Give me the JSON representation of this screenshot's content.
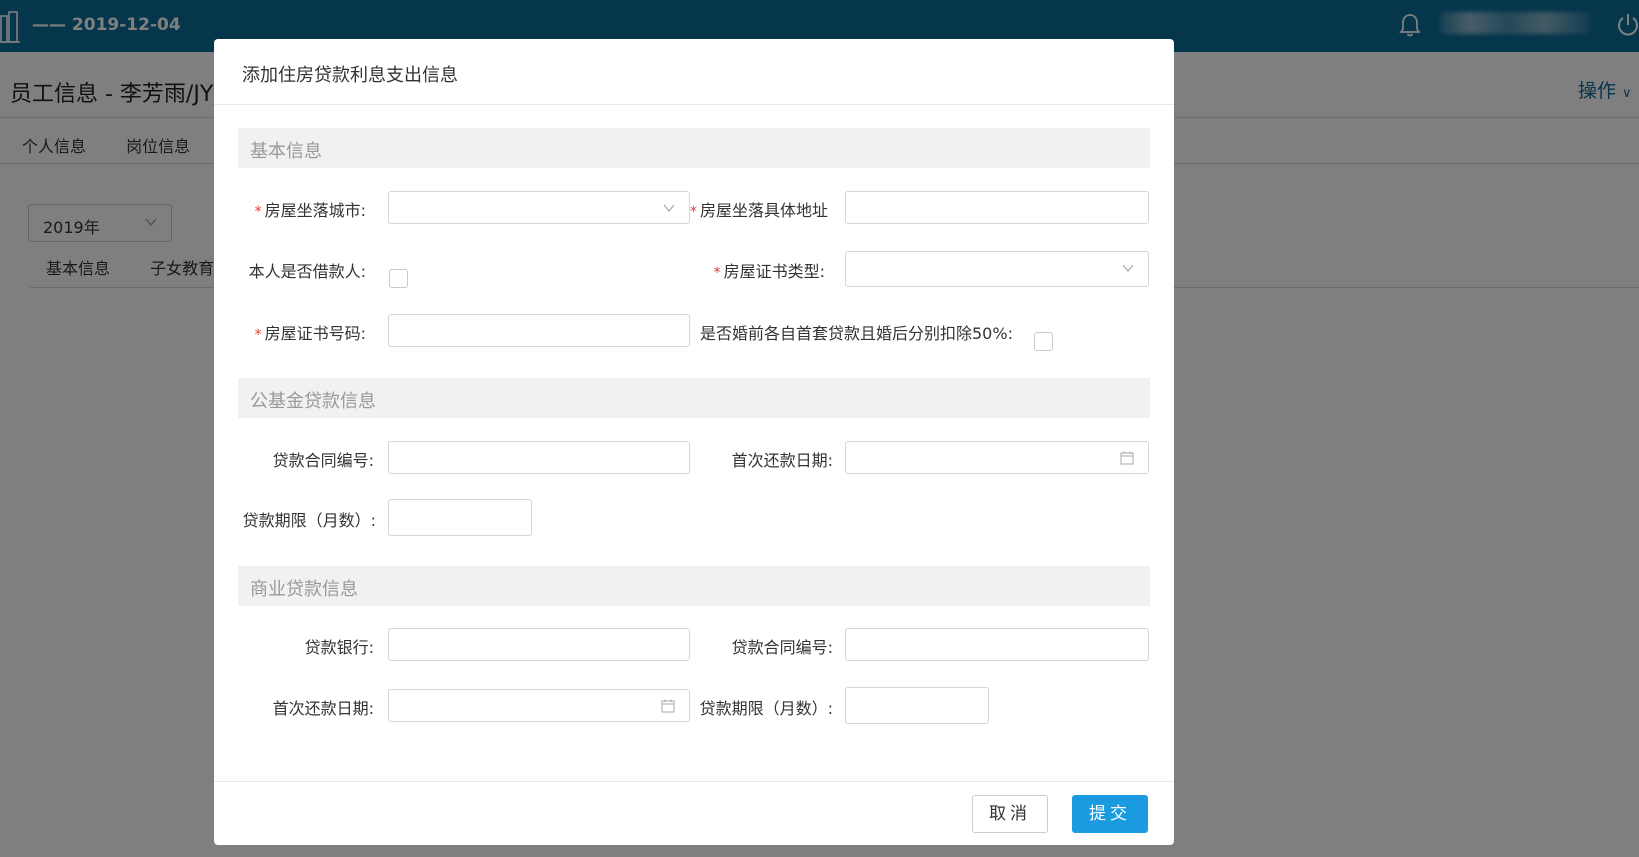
{
  "header": {
    "date": "—— 2019-12-04"
  },
  "page": {
    "title": "员工信息 - 李芳雨/JYS",
    "ops_label": "操作",
    "tabs": [
      "个人信息",
      "岗位信息"
    ],
    "year_select": "2019年",
    "subtabs": [
      "基本信息",
      "子女教育"
    ]
  },
  "modal": {
    "title": "添加住房贷款利息支出信息",
    "sections": {
      "basic": "基本信息",
      "fund": "公基金贷款信息",
      "commercial": "商业贷款信息"
    },
    "fields": {
      "city": "房屋坐落城市:",
      "address": "房屋坐落具体地址",
      "is_borrower": "本人是否借款人:",
      "cert_type": "房屋证书类型:",
      "cert_no": "房屋证书号码:",
      "split_50": "是否婚前各自首套贷款且婚后分别扣除50%:",
      "fund_contract": "贷款合同编号:",
      "fund_first_date": "首次还款日期:",
      "fund_term": "贷款期限（月数）:",
      "bank": "贷款银行:",
      "com_contract": "贷款合同编号:",
      "com_first_date": "首次还款日期:",
      "com_term": "贷款期限（月数）:"
    },
    "required_mark": "*",
    "buttons": {
      "cancel": "取消",
      "submit": "提交"
    }
  },
  "colors": {
    "header": "#0b6c98",
    "primary": "#1a9be0",
    "required": "#e53935"
  },
  "icons": [
    "building-logo-icon",
    "bell-icon",
    "power-icon",
    "chevron-down-icon",
    "calendar-icon"
  ]
}
